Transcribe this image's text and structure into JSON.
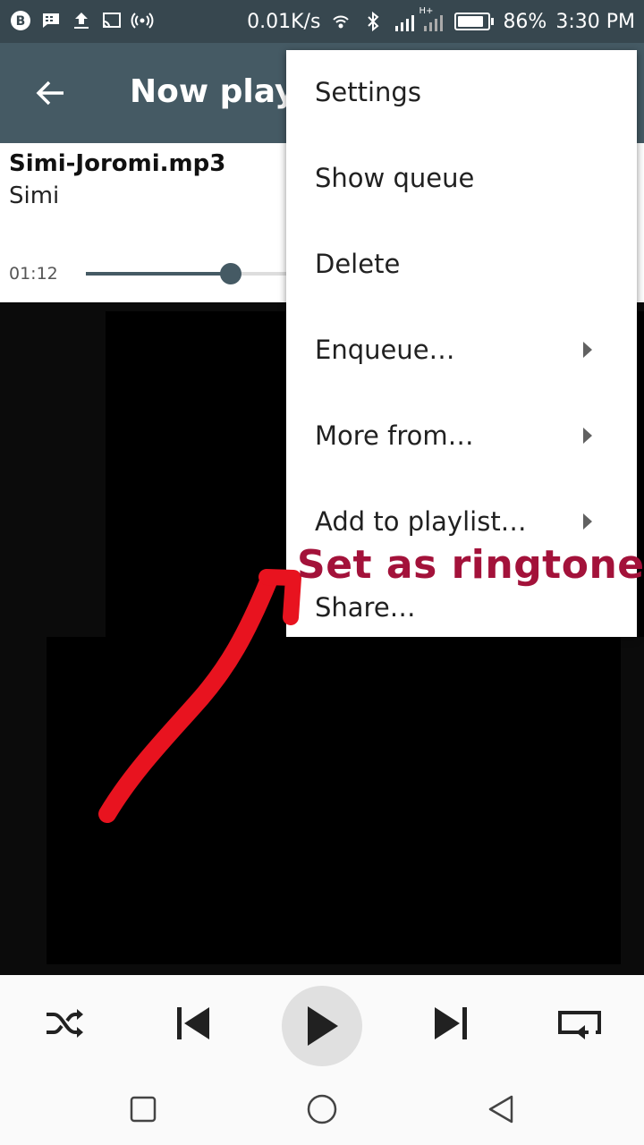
{
  "status_bar": {
    "net_speed": "0.01K/s",
    "network_type": "H+",
    "battery_percent": "86%",
    "battery_level": 0.86,
    "time": "3:30 PM",
    "icons": [
      "blackberry-messenger-icon",
      "chat-icon",
      "upload-icon",
      "cast-icon",
      "hotspot-icon",
      "wifi-icon",
      "bluetooth-icon",
      "signal-icon",
      "battery-icon"
    ]
  },
  "toolbar": {
    "title": "Now playi",
    "back_icon": "arrow-back-icon"
  },
  "now_playing": {
    "title": "Simi-Joromi.mp3",
    "artist": "Simi",
    "elapsed": "01:12",
    "progress": 0.27
  },
  "menu": {
    "items": [
      {
        "label": "Settings",
        "has_submenu": false
      },
      {
        "label": "Show queue",
        "has_submenu": false
      },
      {
        "label": "Delete",
        "has_submenu": false
      },
      {
        "label": "Enqueue…",
        "has_submenu": true
      },
      {
        "label": "More from…",
        "has_submenu": true
      },
      {
        "label": "Add to playlist…",
        "has_submenu": true
      },
      {
        "label": "Share…",
        "has_submenu": false
      }
    ]
  },
  "annotation": {
    "text": "Set as ringtone",
    "color": "#a3123a",
    "arrow_color": "#e8131f"
  },
  "controls": {
    "shuffle_icon": "shuffle-icon",
    "previous_icon": "skip-previous-icon",
    "play_icon": "play-icon",
    "next_icon": "skip-next-icon",
    "repeat_icon": "repeat-icon"
  },
  "nav_bar": {
    "icons": [
      "recents-square-icon",
      "home-circle-icon",
      "back-triangle-icon"
    ]
  },
  "colors": {
    "toolbar": "#455a64",
    "status_bar": "#37474f",
    "accent": "#455a64"
  }
}
